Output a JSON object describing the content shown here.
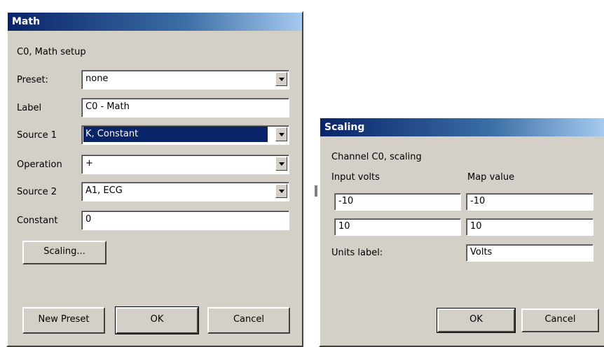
{
  "math_dialog": {
    "title": "Math",
    "subtitle": "C0, Math setup",
    "preset_label": "Preset:",
    "preset_value": "none",
    "label_label": "Label",
    "label_value": "C0 - Math",
    "source1_label": "Source 1",
    "source1_value": "K, Constant",
    "operation_label": "Operation",
    "operation_value": "+",
    "source2_label": "Source 2",
    "source2_value": "A1, ECG",
    "constant_label": "Constant",
    "constant_value": "0",
    "scaling_button": "Scaling...",
    "new_preset_button": "New Preset",
    "ok_button": "OK",
    "cancel_button": "Cancel"
  },
  "scaling_dialog": {
    "title": "Scaling",
    "subtitle": "Channel C0, scaling",
    "input_volts_header": "Input volts",
    "map_value_header": "Map value",
    "rows": [
      {
        "input": "-10",
        "map": "-10"
      },
      {
        "input": "10",
        "map": "10"
      }
    ],
    "units_label": "Units label:",
    "units_value": "Volts",
    "ok_button": "OK",
    "cancel_button": "Cancel"
  },
  "colors": {
    "dialog_bg": "#d4d0c8",
    "title_start": "#0a246a",
    "title_end": "#a6caf0",
    "selection": "#0a246a"
  }
}
